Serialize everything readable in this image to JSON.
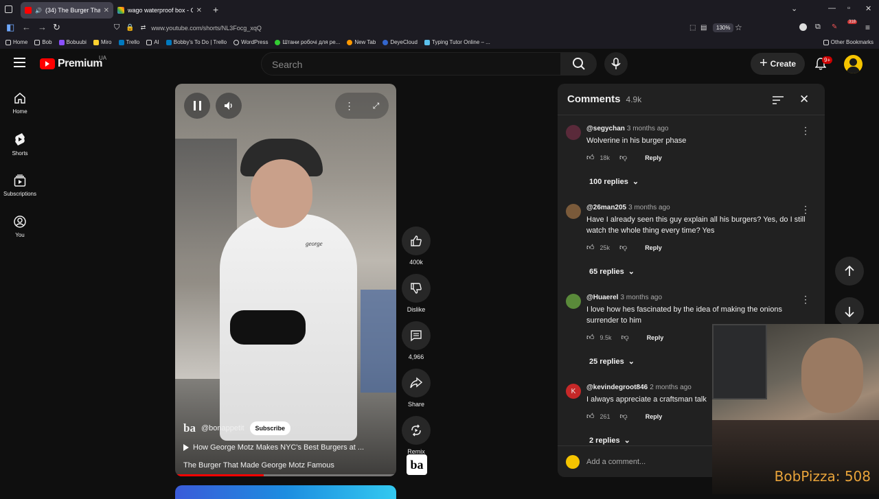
{
  "browser": {
    "tabs": [
      {
        "label": "(34) The Burger That Made",
        "active": true
      },
      {
        "label": "wago waterproof box - Google",
        "active": false
      }
    ],
    "url": "www.youtube.com/shorts/NL3Focg_xqQ",
    "zoom": "130%",
    "bookmarks": [
      "Home",
      "Bob",
      "Bobuubi",
      "Miro",
      "Trello",
      "AI",
      "Bobby's To Do | Trello",
      "WordPress",
      "Штани робочі для ре...",
      "New Tab",
      "DeyeCloud",
      "Typing Tutor Online – ..."
    ],
    "other_bookmarks": "Other Bookmarks",
    "ext_badge": "318"
  },
  "youtube": {
    "logo": "Premium",
    "region": "UA",
    "search_placeholder": "Search",
    "create_label": "Create",
    "notif_badge": "9+"
  },
  "sidebar": [
    {
      "label": "Home",
      "icon": "home-icon"
    },
    {
      "label": "Shorts",
      "icon": "shorts-icon"
    },
    {
      "label": "Subscriptions",
      "icon": "subscriptions-icon"
    },
    {
      "label": "You",
      "icon": "you-icon"
    }
  ],
  "short": {
    "channel": "@bonappetit",
    "channel_logo": "ba",
    "subscribe_label": "Subscribe",
    "linked_video": "How George Motz Makes NYC's Best Burgers at ...",
    "title": "The Burger That Made George Motz Famous",
    "progress": 0.4,
    "shirt_text": "george"
  },
  "actions": {
    "likes": "400k",
    "dislike": "Dislike",
    "comments": "4,966",
    "share": "Share",
    "remix": "Remix"
  },
  "comments": {
    "title": "Comments",
    "count": "4.9k",
    "add_placeholder": "Add a comment...",
    "items": [
      {
        "user": "@segychan",
        "age": "3 months ago",
        "text": "Wolverine in his burger phase",
        "likes": "18k",
        "reply": "Reply",
        "replies": "100 replies",
        "avatar_color": "#5a2a3a"
      },
      {
        "user": "@26man205",
        "age": "3 months ago",
        "text": "Have I already seen this guy explain all his burgers? Yes, do I still watch the whole thing every time? Yes",
        "likes": "25k",
        "reply": "Reply",
        "replies": "65 replies",
        "avatar_color": "#7a5a3a"
      },
      {
        "user": "@Huaerel",
        "age": "3 months ago",
        "text": "I love how hes fascinated by the idea of making the onions surrender to him",
        "likes": "9.5k",
        "reply": "Reply",
        "replies": "25 replies",
        "avatar_color": "#5a8a3a"
      },
      {
        "user": "@kevindegroot846",
        "age": "2 months ago",
        "text": "I always appreciate a craftsman talk",
        "likes": "261",
        "reply": "Reply",
        "replies": "2 replies",
        "avatar_color": "#c62828",
        "avatar_letter": "K"
      }
    ]
  },
  "overlay": {
    "webcam_label": "BobPizza: 508"
  }
}
